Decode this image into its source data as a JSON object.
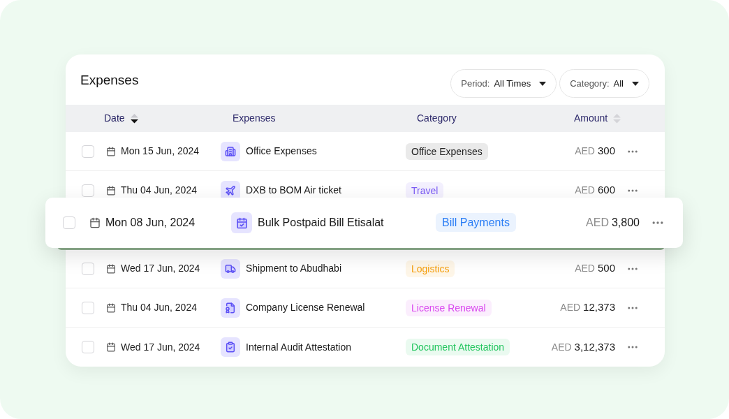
{
  "title": "Expenses",
  "filters": [
    {
      "label": "Period:",
      "value": "All Times"
    },
    {
      "label": "Category:",
      "value": "All"
    }
  ],
  "columns": [
    {
      "label": "Date",
      "sortable": true,
      "sorted": true
    },
    {
      "label": "Expenses",
      "sortable": false,
      "sorted": false
    },
    {
      "label": "Category",
      "sortable": false,
      "sorted": false
    },
    {
      "label": "Amount",
      "sortable": true,
      "sorted": false
    }
  ],
  "rows": [
    {
      "checked": false,
      "date": "Mon 15 Jun, 2024",
      "kind": "office",
      "expense": "Office Expenses",
      "category": "Office Expenses",
      "color": "#222222",
      "currency": "AED",
      "amount": "300"
    },
    {
      "checked": false,
      "date": "Thu 04 Jun, 2024",
      "kind": "travel",
      "expense": "DXB to BOM Air ticket",
      "category": "Travel",
      "color": "#7c5cf5",
      "currency": "AED",
      "amount": "600"
    },
    {
      "checked": false,
      "date": "Wed 17 Jun, 2024",
      "kind": "shipping",
      "expense": "Shipment to Abudhabi",
      "category": "Logistics",
      "color": "#f59e0b",
      "currency": "AED",
      "amount": "500"
    },
    {
      "checked": false,
      "date": "Thu 04 Jun, 2024",
      "kind": "license",
      "expense": "Company License Renewal",
      "category": "License Renewal",
      "color": "#d946ef",
      "currency": "AED",
      "amount": "12,373"
    },
    {
      "checked": false,
      "date": "Wed 17 Jun, 2024",
      "kind": "audit",
      "expense": "Internal Audit Attestation",
      "category": "Document Attestation",
      "color": "#22c55e",
      "currency": "AED",
      "amount": "3,12,373"
    }
  ],
  "dragged_row": {
    "checked": false,
    "date": "Mon 08 Jun, 2024",
    "kind": "bill",
    "expense": "Bulk Postpaid Bill Etisalat",
    "category": "Bill Payments",
    "color": "#2a7df5",
    "currency": "AED",
    "amount": "3,800"
  }
}
